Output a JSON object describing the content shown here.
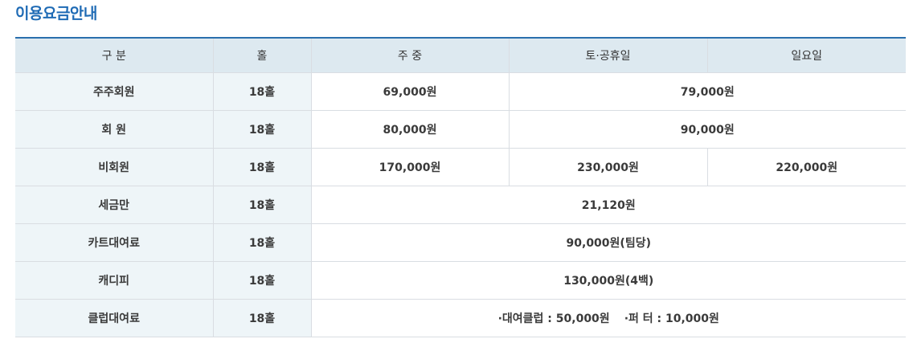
{
  "title": "이용요금안내",
  "table": {
    "headers": [
      "구 분",
      "홀",
      "주 중",
      "토·공휴일",
      "일요일"
    ],
    "rows": [
      {
        "label": "주주회원",
        "holes": "18홀",
        "weekday": "69,000원",
        "weekend": "79,000원"
      },
      {
        "label": "회 원",
        "holes": "18홀",
        "weekday": "80,000원",
        "weekend": "90,000원"
      },
      {
        "label": "비회원",
        "holes": "18홀",
        "weekday": "170,000원",
        "saturday": "230,000원",
        "sunday": "220,000원"
      },
      {
        "label": "세금만",
        "holes": "18홀",
        "fee": "21,120원"
      },
      {
        "label": "카트대여료",
        "holes": "18홀",
        "fee": "90,000원(팀당)"
      },
      {
        "label": "캐디피",
        "holes": "18홀",
        "fee": "130,000원(4백)"
      },
      {
        "label": "클럽대여료",
        "holes": "18홀",
        "fee_part1": "·대여클럽 : 50,000원",
        "fee_part2": "·퍼 터 : 10,000원"
      }
    ]
  }
}
